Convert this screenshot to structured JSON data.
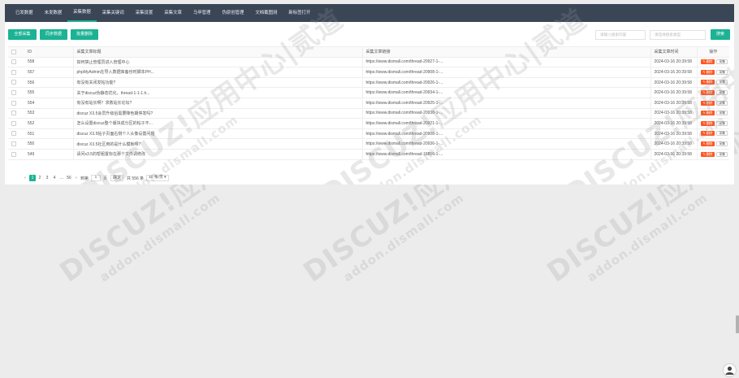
{
  "nav": [
    "已发数据",
    "未发数据",
    "采集数据",
    "采集关键词",
    "采集设置",
    "采集文章",
    "马甲管理",
    "伪原创管理",
    "文档截图测",
    "新标签打开"
  ],
  "nav_active": 2,
  "toolbar": {
    "collect_all": "全部采集",
    "sync_data": "同步数据",
    "batch_delete": "批量删除",
    "search_placeholder_1": "请输入搜索内容",
    "search_placeholder_2": "请选择搜索类型",
    "search_button": "搜索"
  },
  "table": {
    "headers": [
      "ID",
      "采集文章标题",
      "采集文章链接",
      "采集文章时间",
      "操作"
    ],
    "rows": [
      {
        "id": "558",
        "title": "如何禁止管理员进入管理中心",
        "url": "https://www.dismall.com/thread-20927-1-...",
        "time": "2024-03-16 20:39:58"
      },
      {
        "id": "557",
        "title": "phpMyAdmin在导入数据库备份时脚本PH...",
        "url": "https://www.dismall.com/thread-20908-1-...",
        "time": "2024-03-16 20:39:58"
      },
      {
        "id": "556",
        "title": "有没有关闭发帖功能?",
        "url": "https://www.dismall.com/thread-20926-1-...",
        "time": "2024-03-16 20:39:58"
      },
      {
        "id": "555",
        "title": "关于discuz伪静态优化，thread-1-1-1.h...",
        "url": "https://www.dismall.com/thread-20934-1-...",
        "time": "2024-03-16 20:39:58"
      },
      {
        "id": "554",
        "title": "有没有站长啊？求救站长论坛?",
        "url": "https://www.dismall.com/thread-20925-1-...",
        "time": "2024-03-16 20:39:58"
      },
      {
        "id": "553",
        "title": "discuz X3.5会员升级后需要降色期停发吗?",
        "url": "https://www.dismall.com/thread-20938-1-...",
        "time": "2024-03-16 20:39:58"
      },
      {
        "id": "552",
        "title": "怎么设置discuz整个版块成分区的帖子不...",
        "url": "https://www.dismall.com/thread-20921-1-...",
        "time": "2024-03-16 20:39:58"
      },
      {
        "id": "551",
        "title": "discuz X3.5帖子页面右侧个人头像设置问题",
        "url": "https://www.dismall.com/thread-20908-1-...",
        "time": "2024-03-16 20:39:58"
      },
      {
        "id": "550",
        "title": "discuz X3.5社区用的是什么模板啊?",
        "url": "https://www.dismall.com/thread-20936-1-...",
        "time": "2024-03-16 20:39:58"
      },
      {
        "id": "549",
        "title": "请问x3.5的帮租置标在那个文件调修改",
        "url": "https://www.dismall.com/thread-16856-1-...",
        "time": "2024-03-16 20:39:58"
      }
    ],
    "delete_label": "删除",
    "collect_label": "采集"
  },
  "pager": {
    "prev": "‹",
    "pages": [
      "1",
      "2",
      "3",
      "4",
      "...",
      "56"
    ],
    "current": "1",
    "next": "›",
    "goto_label": "到第",
    "goto_value": "1",
    "page_unit": "页",
    "confirm": "确定",
    "total": "共 556 条",
    "page_size": "10 条/页"
  },
  "watermark": {
    "big": "DISCUZ!应用中心|贰道",
    "small": "addon.dismall.com"
  },
  "colors": {
    "nav_bg": "#3a4656",
    "accent": "#1bb394",
    "danger": "#ff5722"
  }
}
